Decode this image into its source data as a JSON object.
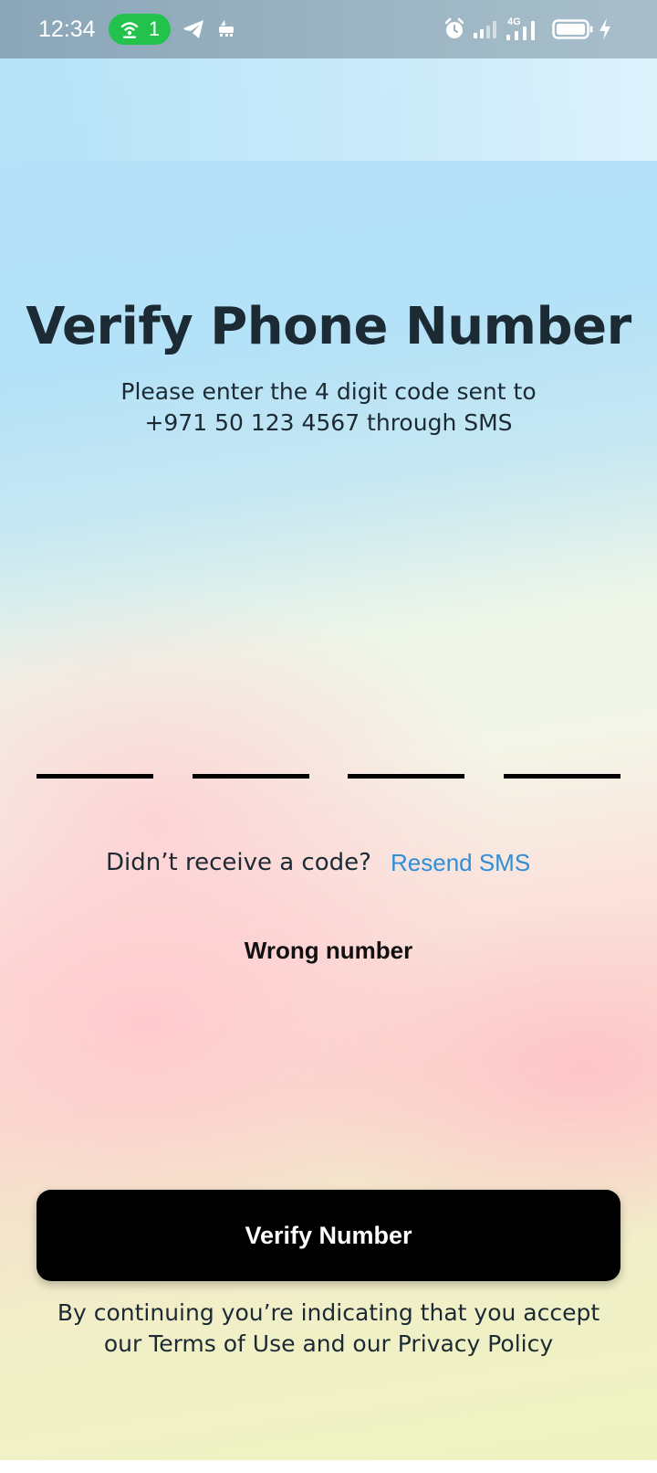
{
  "status_bar": {
    "time": "12:34",
    "hotspot_count": "1",
    "icons": [
      "hotspot-icon",
      "telegram-icon",
      "notification-icon",
      "alarm-icon",
      "signal-icon",
      "4g-signal-icon",
      "battery-icon",
      "charging-icon"
    ],
    "network_label": "4G"
  },
  "main": {
    "title": "Verify Phone Number",
    "subtitle_line1": "Please enter the 4 digit code sent to",
    "subtitle_line2": "+971 50 123 4567 through SMS",
    "code_fields": [
      "",
      "",
      "",
      ""
    ],
    "resend_prompt": "Didn’t receive a code?",
    "resend_link": "Resend SMS",
    "wrong_number": "Wrong number",
    "verify_button": "Verify Number",
    "terms_line1": "By continuing you’re indicating that you accept",
    "terms_line2": "our Terms of Use and our Privacy Policy"
  },
  "colors": {
    "title_text": "#1c2a33",
    "link": "#2e8fd8",
    "button_bg": "#000000",
    "button_text": "#ffffff",
    "hotspot_pill": "#22c24d"
  }
}
